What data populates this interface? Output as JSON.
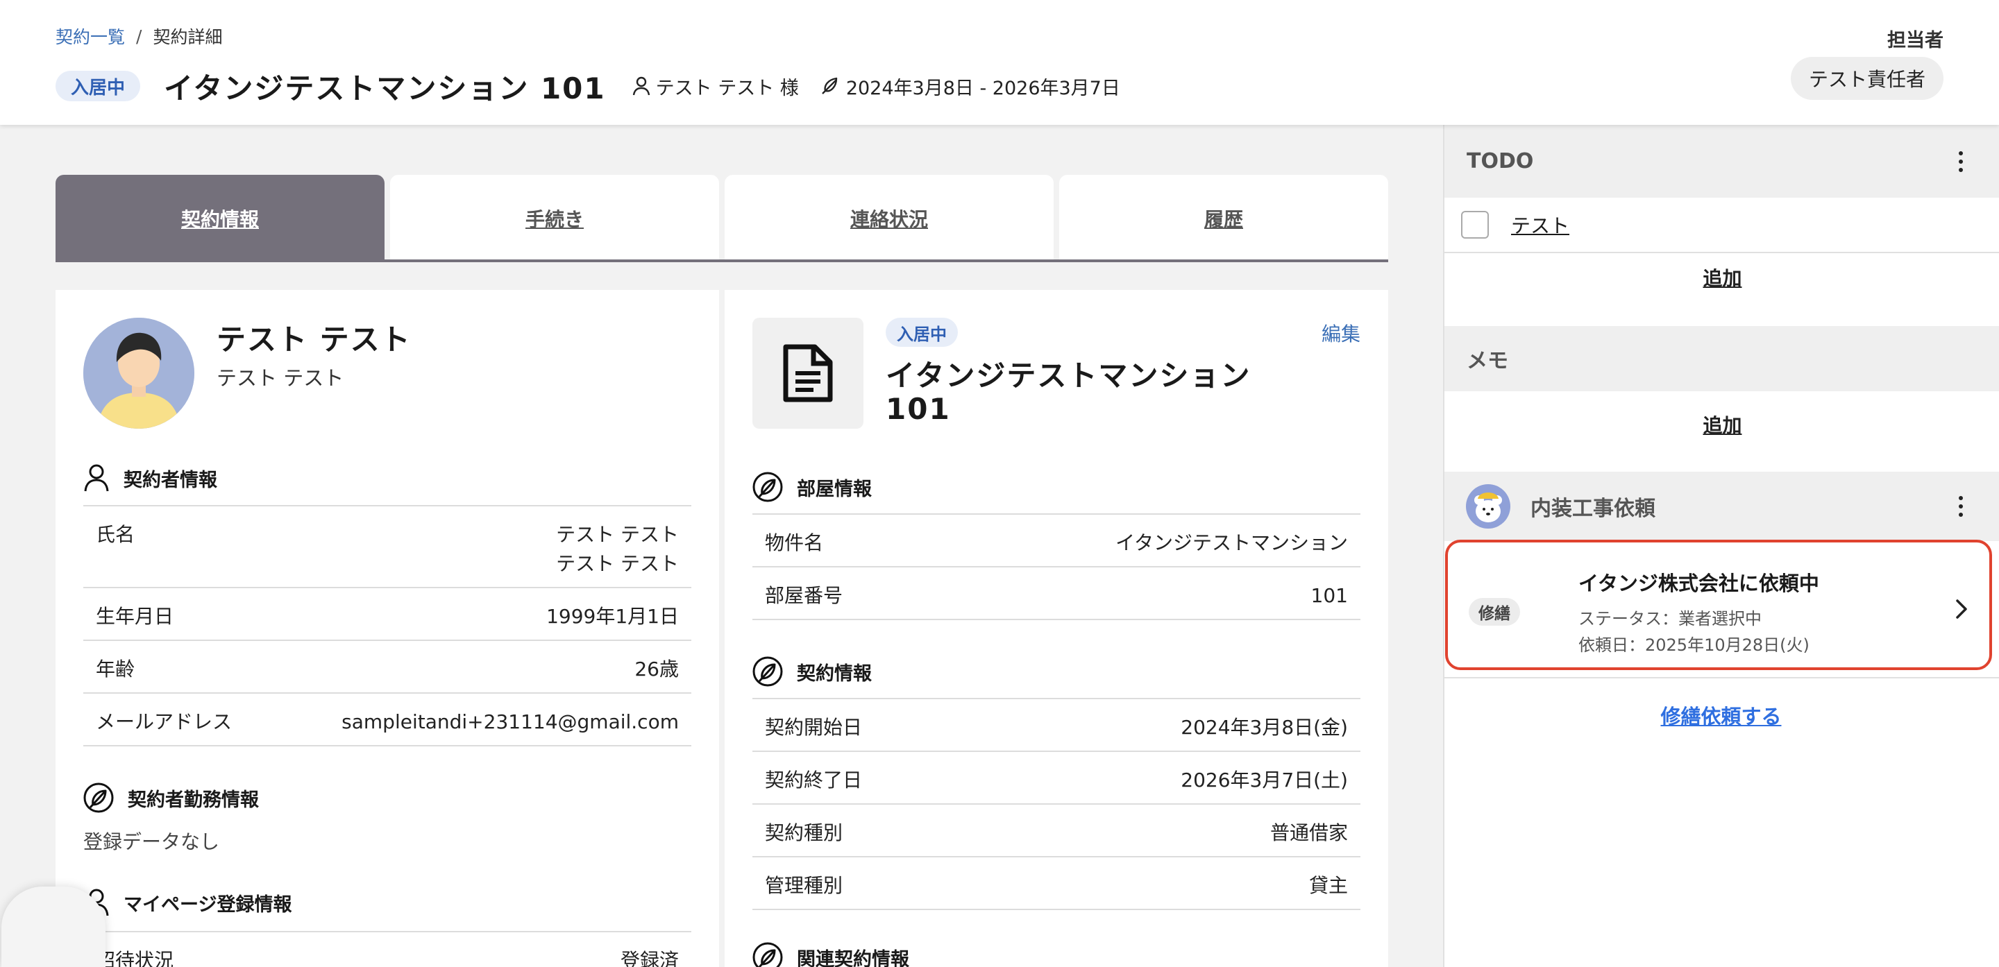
{
  "breadcrumb": {
    "list": "契約一覧",
    "sep": "/",
    "current": "契約詳細"
  },
  "header": {
    "status_badge": "入居中",
    "title": "イタンジテストマンション 101",
    "tenant": "テスト テスト 様",
    "period": "2024年3月8日 - 2026年3月7日",
    "assignee_label": "担当者",
    "assignee": "テスト責任者"
  },
  "tabs": [
    {
      "label": "契約情報",
      "active": true
    },
    {
      "label": "手続き"
    },
    {
      "label": "連絡状況"
    },
    {
      "label": "履歴"
    }
  ],
  "person": {
    "name": "テスト テスト",
    "sub": "テスト テスト",
    "contractor_section": "契約者情報",
    "rows": [
      {
        "key": "氏名",
        "val1": "テスト テスト",
        "val2": "テスト テスト"
      },
      {
        "key": "生年月日",
        "val": "1999年1月1日"
      },
      {
        "key": "年齢",
        "val": "26歳"
      },
      {
        "key": "メールアドレス",
        "val": "sampleitandi+231114@gmail.com"
      }
    ],
    "work_section": "契約者勤務情報",
    "work_empty": "登録データなし",
    "mypage_section": "マイページ登録情報",
    "mypage_rows": [
      {
        "key": "招待状況",
        "val": "登録済"
      }
    ]
  },
  "property": {
    "badge": "入居中",
    "edit": "編集",
    "title_line1": "イタンジテストマンション",
    "title_line2": "101",
    "room_section": "部屋情報",
    "room_rows": [
      {
        "key": "物件名",
        "val": "イタンジテストマンション"
      },
      {
        "key": "部屋番号",
        "val": "101"
      }
    ],
    "contract_section": "契約情報",
    "contract_rows": [
      {
        "key": "契約開始日",
        "val": "2024年3月8日(金)"
      },
      {
        "key": "契約終了日",
        "val": "2026年3月7日(土)"
      },
      {
        "key": "契約種別",
        "val": "普通借家"
      },
      {
        "key": "管理種別",
        "val": "貸主"
      }
    ],
    "related_section": "関連契約情報"
  },
  "side": {
    "todo_title": "TODO",
    "todo_items": [
      {
        "label": "テスト",
        "checked": false
      }
    ],
    "todo_add": "追加",
    "memo_title": "メモ",
    "memo_add": "追加",
    "interior_title": "内装工事依頼",
    "repair": {
      "tag": "修繕",
      "title": "イタンジ株式会社に依頼中",
      "status": "ステータス：業者選択中",
      "date": "依頼日：2025年10月28日(火)"
    },
    "repair_link": "修繕依頼する"
  },
  "colors": {
    "accent": "#2f5fb3",
    "tab_active": "#74707b",
    "alert_border": "#e0432f",
    "link": "#2f6fe0"
  }
}
